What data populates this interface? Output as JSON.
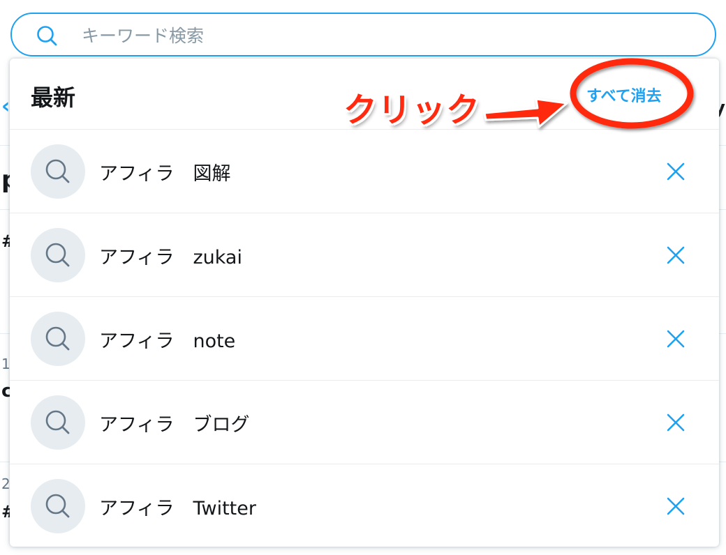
{
  "search": {
    "placeholder": "キーワード検索",
    "value": ""
  },
  "recent": {
    "title": "最新",
    "clear_all_label": "すべて消去",
    "items": [
      {
        "label": "アフィラ　図解"
      },
      {
        "label": "アフィラ　zukai"
      },
      {
        "label": "アフィラ　note"
      },
      {
        "label": "アフィラ　ブログ"
      },
      {
        "label": "アフィラ　Twitter"
      }
    ]
  },
  "annotation": {
    "text": "クリック"
  },
  "colors": {
    "accent": "#1da1f2",
    "annotation_red": "#ff2a10",
    "avatar_bg": "#e6ecf0",
    "icon_gray": "#657786"
  }
}
